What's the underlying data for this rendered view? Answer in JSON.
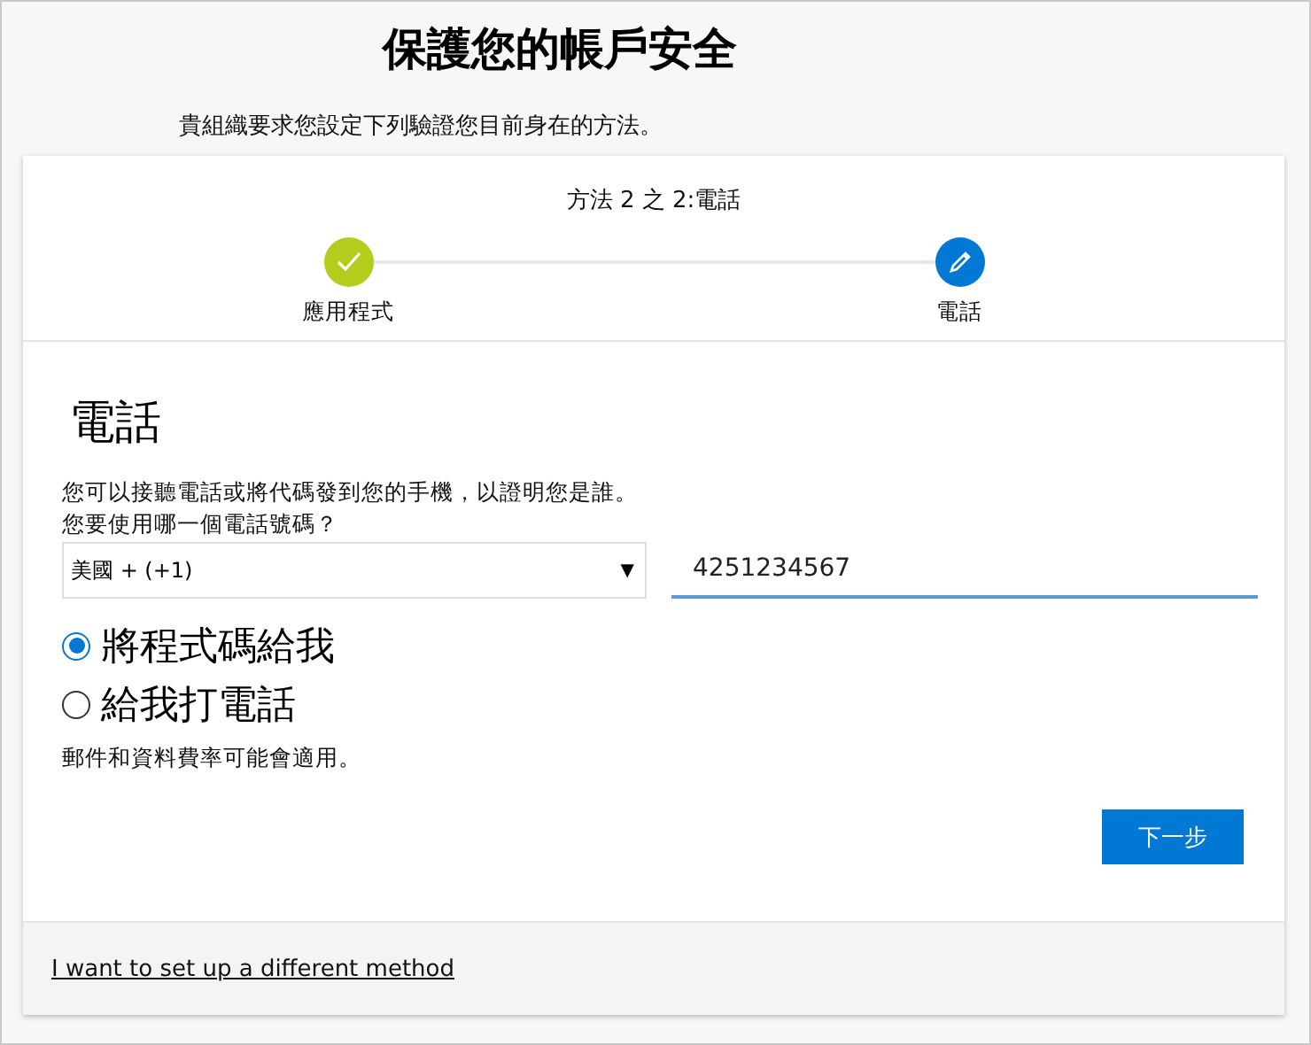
{
  "title": "保護您的帳戶安全",
  "subtitle": "貴組織要求您設定下列驗證您目前身在的方法。",
  "progress": {
    "text": "方法 2 之 2:電話",
    "steps": [
      {
        "label": "應用程式",
        "kind": "done"
      },
      {
        "label": "電話",
        "kind": "current"
      }
    ]
  },
  "section": {
    "heading": "電話",
    "description": "您可以接聽電話或將代碼發到您的手機，以證明您是誰。",
    "question": "您要使用哪一個電話號碼？",
    "country_select": {
      "value": "美國 + (+1)",
      "arrow": "▼"
    },
    "phone_field": {
      "value": "4251234567"
    },
    "options": [
      {
        "label": "將程式碼給我",
        "selected": true
      },
      {
        "label": "給我打電話",
        "selected": false
      }
    ],
    "note": "郵件和資料費率可能會適用。",
    "next_button": "下一步"
  },
  "footer": {
    "link": "I want to set up a different method"
  }
}
